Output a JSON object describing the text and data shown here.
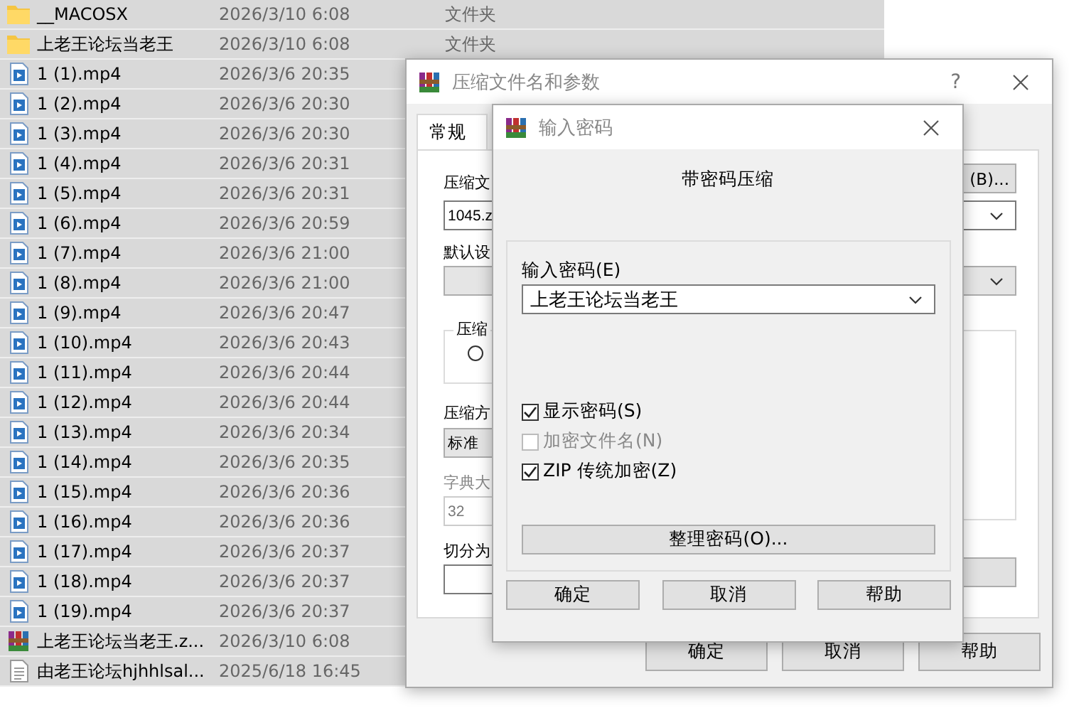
{
  "files": {
    "rows": [
      {
        "kind": "folder",
        "name": "__MACOSX",
        "date": "2026/3/10 6:08",
        "type": "文件夹",
        "selected": true
      },
      {
        "kind": "folder",
        "name": "上老王论坛当老王",
        "date": "2026/3/10 6:08",
        "type": "文件夹",
        "selected": true
      },
      {
        "kind": "video",
        "name": "1 (1).mp4",
        "date": "2026/3/6 20:35",
        "selected": true
      },
      {
        "kind": "video",
        "name": "1 (2).mp4",
        "date": "2026/3/6 20:30",
        "selected": true
      },
      {
        "kind": "video",
        "name": "1 (3).mp4",
        "date": "2026/3/6 20:30",
        "selected": true
      },
      {
        "kind": "video",
        "name": "1 (4).mp4",
        "date": "2026/3/6 20:31",
        "selected": true
      },
      {
        "kind": "video",
        "name": "1 (5).mp4",
        "date": "2026/3/6 20:31",
        "selected": true
      },
      {
        "kind": "video",
        "name": "1 (6).mp4",
        "date": "2026/3/6 20:59",
        "selected": true
      },
      {
        "kind": "video",
        "name": "1 (7).mp4",
        "date": "2026/3/6 21:00",
        "selected": true
      },
      {
        "kind": "video",
        "name": "1 (8).mp4",
        "date": "2026/3/6 21:00",
        "selected": true
      },
      {
        "kind": "video",
        "name": "1 (9).mp4",
        "date": "2026/3/6 20:47",
        "selected": true
      },
      {
        "kind": "video",
        "name": "1 (10).mp4",
        "date": "2026/3/6 20:43",
        "selected": true
      },
      {
        "kind": "video",
        "name": "1 (11).mp4",
        "date": "2026/3/6 20:44",
        "selected": true
      },
      {
        "kind": "video",
        "name": "1 (12).mp4",
        "date": "2026/3/6 20:44",
        "selected": true
      },
      {
        "kind": "video",
        "name": "1 (13).mp4",
        "date": "2026/3/6 20:34",
        "selected": true
      },
      {
        "kind": "video",
        "name": "1 (14).mp4",
        "date": "2026/3/6 20:35",
        "selected": true
      },
      {
        "kind": "video",
        "name": "1 (15).mp4",
        "date": "2026/3/6 20:36",
        "selected": true
      },
      {
        "kind": "video",
        "name": "1 (16).mp4",
        "date": "2026/3/6 20:36",
        "selected": true
      },
      {
        "kind": "video",
        "name": "1 (17).mp4",
        "date": "2026/3/6 20:37",
        "selected": true
      },
      {
        "kind": "video",
        "name": "1 (18).mp4",
        "date": "2026/3/6 20:37",
        "selected": true
      },
      {
        "kind": "video",
        "name": "1 (19).mp4",
        "date": "2026/3/6 20:37",
        "selected": true
      },
      {
        "kind": "archive",
        "name": "上老王论坛当老王.z...",
        "date": "2026/3/10 6:08",
        "selected": true
      },
      {
        "kind": "text",
        "name": "由老王论坛hjhhlsal...",
        "date": "2025/6/18 16:45",
        "selected": true
      }
    ]
  },
  "compress_dialog": {
    "title": "压缩文件名和参数",
    "help_button": "?",
    "tabs": [
      {
        "label": "常规",
        "selected": true
      }
    ],
    "archive_name_label": "压缩文",
    "browse_button": "(B)...",
    "archive_name": "1045.z",
    "profile_label": "默认设",
    "format_group": {
      "title": "压缩",
      "option": {
        "selected": false
      }
    },
    "method_label": "压缩方",
    "method": "标准",
    "dictionary": {
      "label": "字典大",
      "value": "32",
      "disabled": true
    },
    "split_label": "切分为",
    "buttons": [
      "确定",
      "取消",
      "帮助"
    ]
  },
  "password_dialog": {
    "title": "输入密码",
    "heading": "带密码压缩",
    "password_label": "输入密码(E)",
    "password": "上老王论坛当老王",
    "options": [
      {
        "label": "显示密码(S)",
        "checked": true,
        "disabled": false
      },
      {
        "label": "加密文件名(N)",
        "checked": false,
        "disabled": true
      },
      {
        "label": "ZIP 传统加密(Z)",
        "checked": true,
        "disabled": false
      }
    ],
    "organize_button": "整理密码(O)...",
    "buttons": [
      "确定",
      "取消",
      "帮助"
    ]
  }
}
